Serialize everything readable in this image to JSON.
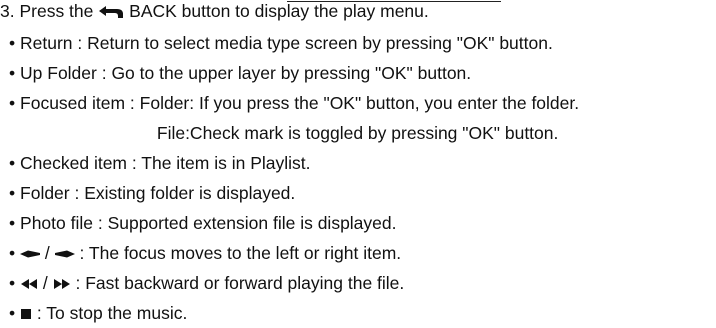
{
  "heading": {
    "prefix": "3. Press the",
    "icon": "back-arrow-icon",
    "suffix": "BACK button to display the play menu."
  },
  "items": [
    {
      "bullet": "•",
      "text": "Return : Return to select media type screen by pressing \"OK\" button."
    },
    {
      "bullet": "•",
      "text": "Up Folder : Go to the upper layer by pressing \"OK\" button."
    },
    {
      "bullet": "•",
      "text": "Focused item : Folder: If you press the \"OK\" button, you enter the folder."
    },
    {
      "bullet": "",
      "text": "File:Check mark is toggled by pressing \"OK\" button."
    },
    {
      "bullet": "•",
      "text": "Checked item : The item is in Playlist."
    },
    {
      "bullet": "•",
      "text": "Folder : Existing folder is displayed."
    },
    {
      "bullet": "•",
      "text": "Photo file : Supported extension file is displayed."
    },
    {
      "bullet": "•",
      "text": ": The focus moves to the left or right item.",
      "icons": [
        "left-arrow-icon",
        "right-arrow-icon"
      ],
      "separator": "/"
    },
    {
      "bullet": "•",
      "text": ": Fast backward or forward playing the file.",
      "icons": [
        "rewind-icon",
        "fast-forward-icon"
      ],
      "separator": "/"
    },
    {
      "bullet": "•",
      "text": ": To stop the music.",
      "icons": [
        "stop-icon"
      ]
    }
  ]
}
